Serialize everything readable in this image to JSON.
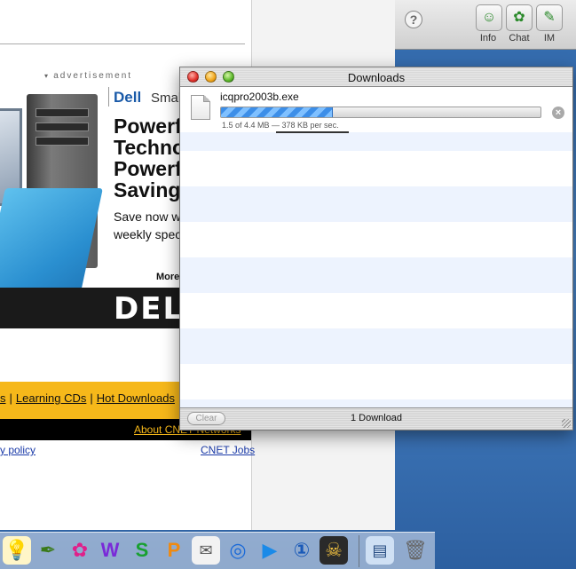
{
  "toolbar": {
    "help_label": "?",
    "tools": [
      {
        "label": "Info",
        "icon": "info-person-icon"
      },
      {
        "label": "Chat",
        "icon": "chat-icon"
      },
      {
        "label": "IM",
        "icon": "im-icon"
      }
    ]
  },
  "web_page": {
    "ad_label": "advertisement",
    "ad": {
      "brand": "Dell",
      "brand_sub": "Small",
      "headline": "Powerf\nTechno\nPowerf\nSavings",
      "copy": "Save now w\nweekly spec",
      "more": "More",
      "logo": "DELL"
    },
    "footer_links": [
      "s",
      "Learning CDs",
      "Hot Downloads"
    ],
    "about_link": "About CNET Networks",
    "privacy_link": "y policy",
    "jobs_link": "CNET Jobs"
  },
  "downloads": {
    "title": "Downloads",
    "file_name": "icqpro2003b.exe",
    "progress_fraction": 0.35,
    "status": "1.5 of 4.4 MB — 378 KB per sec.",
    "clear_label": "Clear",
    "count_label": "1 Download"
  },
  "dock": {
    "items": [
      "lightbulb-icon",
      "pen-icon",
      "flower-icon",
      "app-w-icon",
      "app-s-icon",
      "app-p-icon",
      "document-icon",
      "quicktime-icon",
      "play-icon",
      "number-one-icon",
      "pirate-icon",
      "screen-icon",
      "trash-icon"
    ]
  },
  "colors": {
    "accent_blue": "#3c8ee8",
    "yellow_bar": "#f6b81a",
    "desktop_blue": "#2f65a7"
  }
}
